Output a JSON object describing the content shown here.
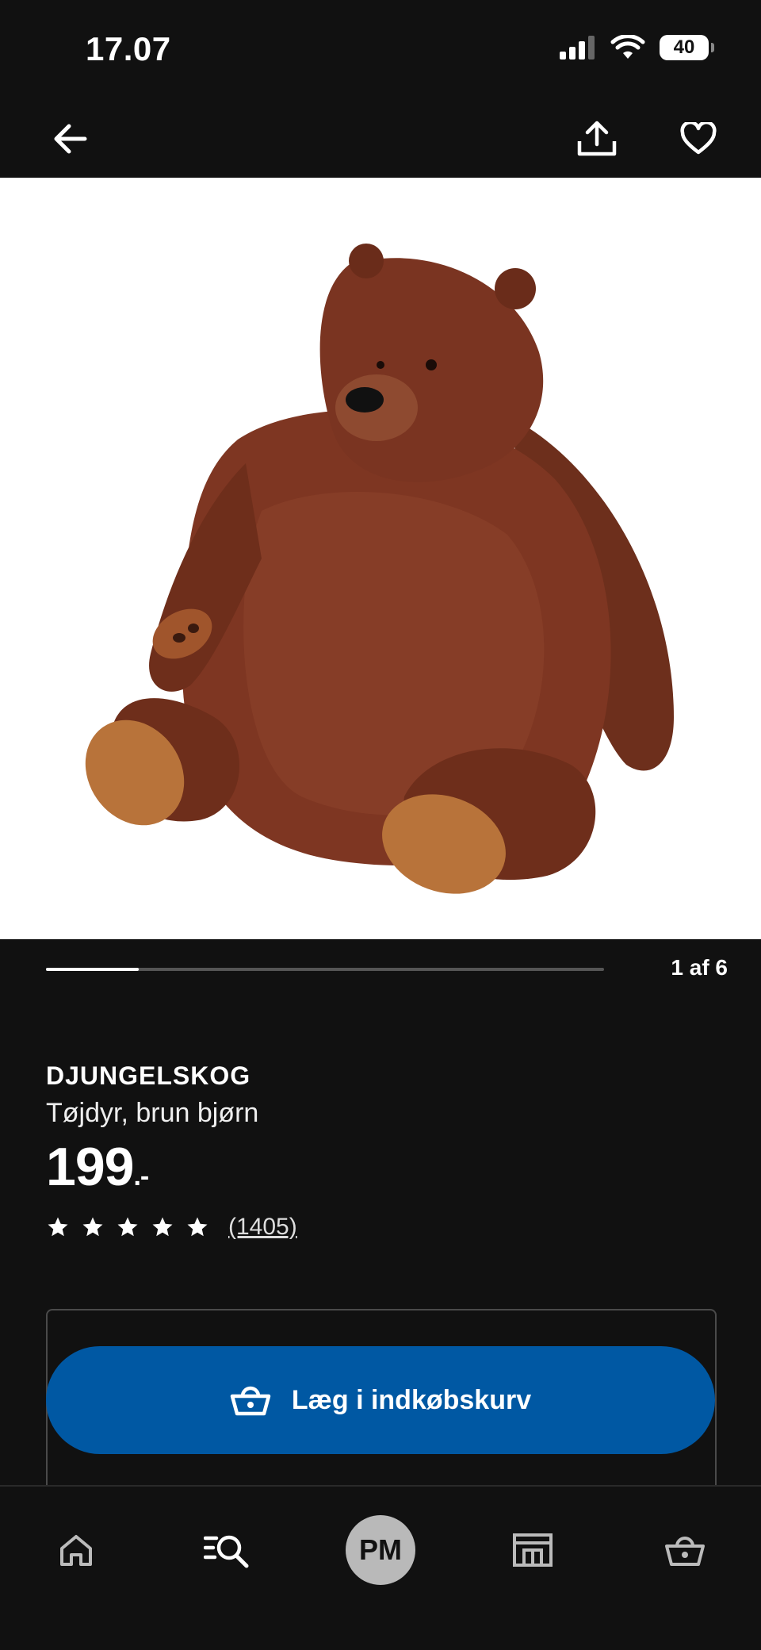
{
  "status_bar": {
    "time": "17.07",
    "battery": "40"
  },
  "icons": {
    "signal": "cellular-signal-icon",
    "wifi": "wifi-icon",
    "back": "arrow-left-icon",
    "share": "share-icon",
    "favorite": "heart-icon",
    "cart": "basket-icon",
    "star": "star-icon",
    "nav_home": "home-icon",
    "nav_search": "search-icon",
    "nav_store": "store-icon",
    "nav_cart": "basket-icon"
  },
  "gallery": {
    "page_indicator": "1 af 6",
    "progress": 0.1667
  },
  "product": {
    "name": "DJUNGELSKOG",
    "description": "Tøjdyr, brun bjørn",
    "price": "199",
    "price_suffix": ".-",
    "rating": 5,
    "review_count": "(1405)"
  },
  "actions": {
    "add_to_cart_label": "Læg i indkøbskurv"
  },
  "bottom_nav": {
    "profile_initials": "PM"
  },
  "colors": {
    "background": "#111111",
    "primary_button": "#0058a3",
    "text": "#ffffff"
  }
}
